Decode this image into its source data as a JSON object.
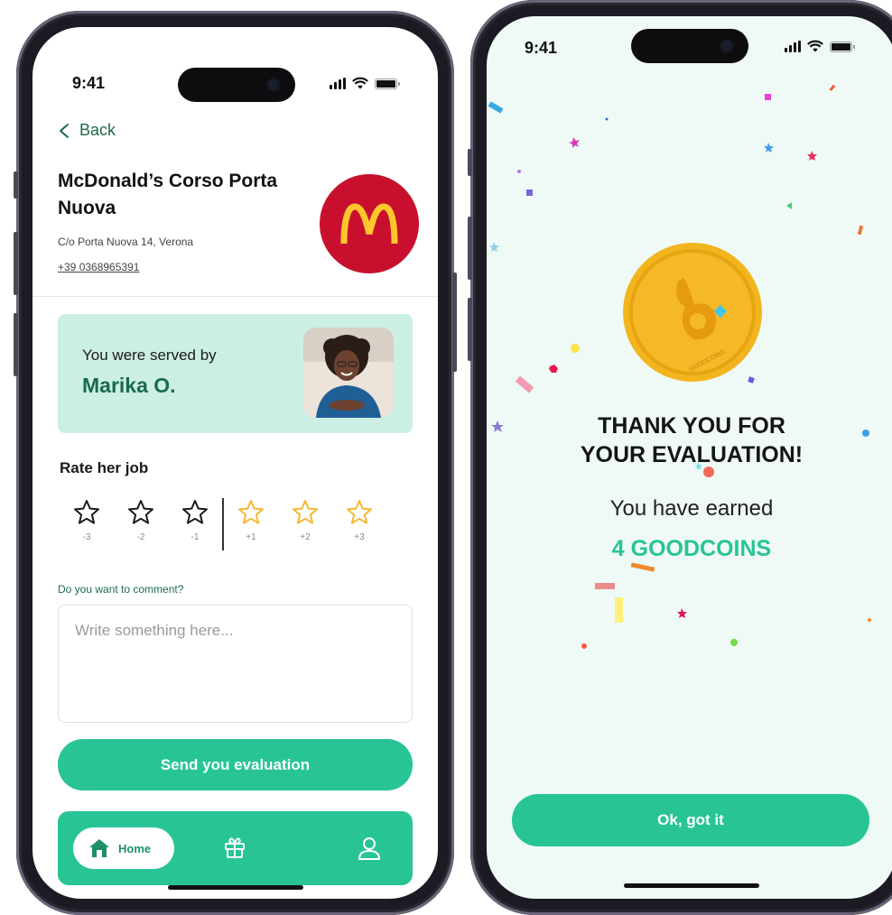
{
  "status_bar": {
    "time": "9:41"
  },
  "left_screen": {
    "back_label": "Back",
    "restaurant": {
      "name": "McDonald’s Corso Porta Nuova",
      "address": "C/o Porta Nuova 14, Verona",
      "phone": "+39 0368965391",
      "logo_letter": "M"
    },
    "served_card": {
      "label": "You were served by",
      "employee_name": "Marika O."
    },
    "rating": {
      "title": "Rate her job",
      "options": [
        {
          "label": "-3",
          "style": "outline-dark"
        },
        {
          "label": "-2",
          "style": "outline-dark"
        },
        {
          "label": "-1",
          "style": "outline-dark"
        },
        {
          "label": "+1",
          "style": "outline-gold"
        },
        {
          "label": "+2",
          "style": "outline-gold"
        },
        {
          "label": "+3",
          "style": "outline-gold"
        }
      ]
    },
    "comment": {
      "question": "Do you want to comment?",
      "placeholder": "Write something here..."
    },
    "submit_label": "Send you evaluation",
    "bottom_nav": {
      "home_label": "Home",
      "items": [
        "home-icon",
        "gift-icon",
        "user-icon"
      ]
    }
  },
  "right_screen": {
    "coin_text": "GOODCOINS",
    "title_line1": "THANK YOU FOR",
    "title_line2": "YOUR EVALUATION!",
    "earned_text": "You have earned",
    "earned_amount": "4 GOODCOINS",
    "ok_label": "Ok, got it"
  },
  "colors": {
    "accent": "#28c496",
    "accent_dark": "#1f6b4a",
    "served_bg": "#ccefe3",
    "mcd_red": "#c8102e",
    "mcd_gold": "#ffc72c",
    "star_gold": "#f5b731",
    "right_bg": "#effaf6",
    "coin_gold": "#f2b51e"
  }
}
